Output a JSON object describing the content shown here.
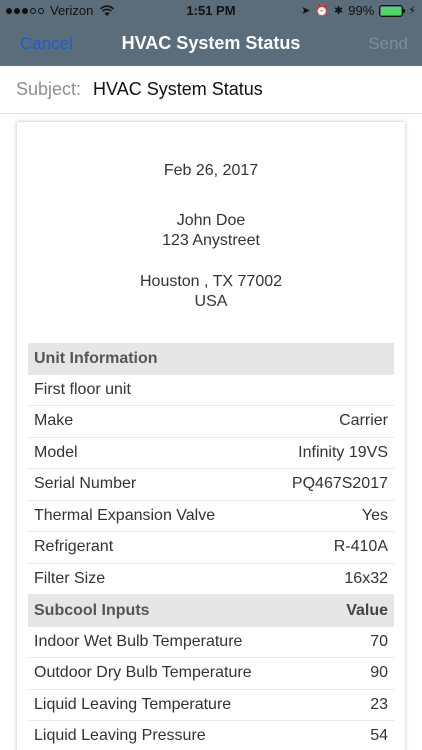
{
  "status_bar": {
    "carrier": "Verizon",
    "time": "1:51 PM",
    "battery_percent": "99%",
    "battery_level": 0.99
  },
  "nav": {
    "cancel_label": "Cancel",
    "title": "HVAC System Status",
    "send_label": "Send"
  },
  "subject": {
    "label": "Subject:",
    "value": "HVAC System Status"
  },
  "document": {
    "date": "Feb 26, 2017",
    "name": "John Doe",
    "street": "123 Anystreet",
    "city_line": "Houston , TX 77002",
    "country": "USA",
    "unit_info": {
      "header": "Unit Information",
      "unit_name": "First floor unit",
      "rows": [
        {
          "label": "Make",
          "value": "Carrier"
        },
        {
          "label": "Model",
          "value": "Infinity 19VS"
        },
        {
          "label": "Serial Number",
          "value": "PQ467S2017"
        },
        {
          "label": "Thermal Expansion Valve",
          "value": "Yes"
        },
        {
          "label": "Refrigerant",
          "value": "R-410A"
        },
        {
          "label": "Filter Size",
          "value": "16x32"
        }
      ]
    },
    "subcool": {
      "header": "Subcool Inputs",
      "header_value": "Value",
      "rows": [
        {
          "label": "Indoor Wet Bulb Temperature",
          "value": "70"
        },
        {
          "label": "Outdoor Dry Bulb Temperature",
          "value": "90"
        },
        {
          "label": "Liquid Leaving Temperature",
          "value": "23"
        },
        {
          "label": "Liquid Leaving Pressure",
          "value": "54"
        }
      ]
    }
  },
  "colors": {
    "header_bg": "#5b6d7a",
    "cancel": "#1a5dd6",
    "send_disabled": "#7e8d98",
    "battery": "#4cd964",
    "section_bg": "#e6e6e6"
  }
}
